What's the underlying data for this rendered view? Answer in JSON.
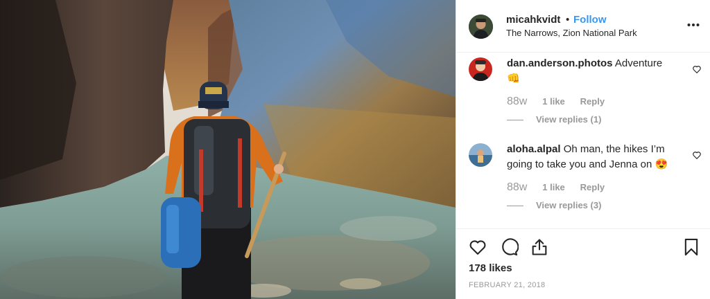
{
  "post": {
    "username": "micahkvidt",
    "separator": "•",
    "follow_label": "Follow",
    "location": "The Narrows, Zion National Park",
    "more_icon": "ellipsis-icon",
    "likes_count": "178 likes",
    "date": "FEBRUARY 21, 2018"
  },
  "comments": [
    {
      "username": "dan.anderson.photos",
      "text": "Adventure",
      "emoji": "👊",
      "time": "88w",
      "likes": "1 like",
      "reply_label": "Reply",
      "view_replies": "View replies (1)"
    },
    {
      "username": "aloha.alpal",
      "text": "Oh man, the hikes I’m going to take you and Jenna on",
      "emoji": "😍",
      "time": "88w",
      "likes": "1 like",
      "reply_label": "Reply",
      "view_replies": "View replies (3)"
    }
  ],
  "colors": {
    "accent": "#3897f0",
    "text": "#262626",
    "muted": "#999999"
  },
  "icons": [
    "heart-icon",
    "comment-icon",
    "share-icon",
    "bookmark-icon"
  ]
}
